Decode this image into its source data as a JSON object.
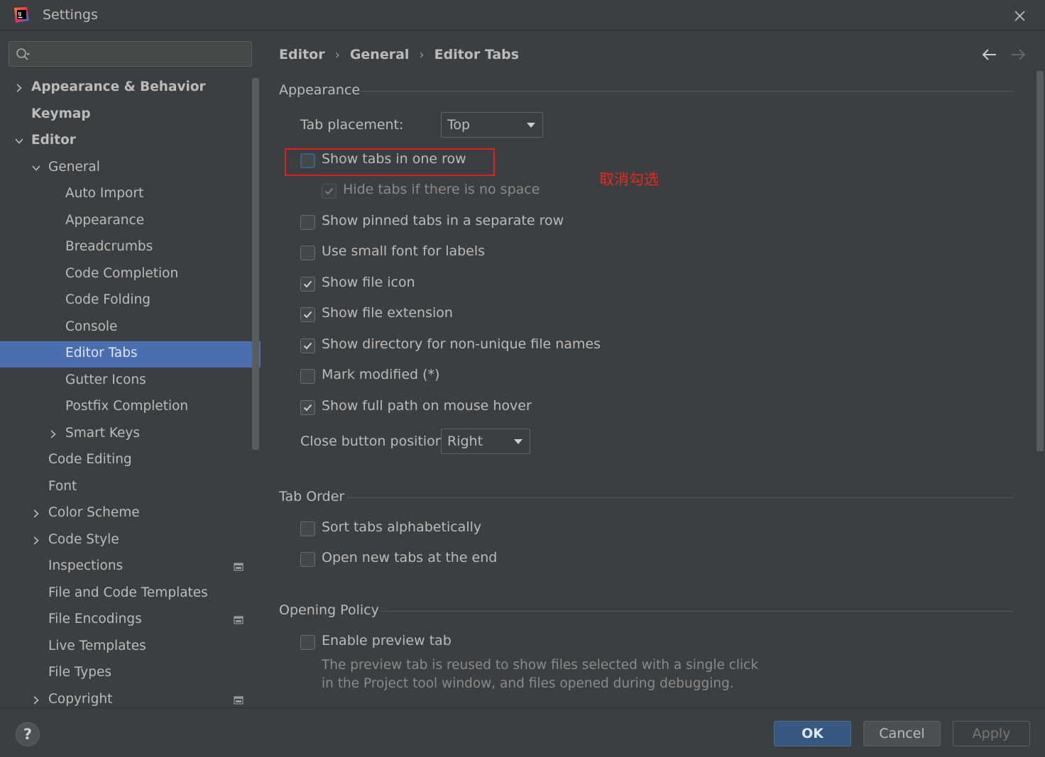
{
  "window": {
    "title": "Settings",
    "logo_icon": "intellij-idea-logo-icon",
    "close_icon": "close-icon"
  },
  "sidebar": {
    "search_placeholder": "",
    "items": [
      {
        "label": "Appearance & Behavior",
        "level": 0,
        "expandable": true,
        "expanded": false,
        "bold": true
      },
      {
        "label": "Keymap",
        "level": 0,
        "expandable": false,
        "bold": true
      },
      {
        "label": "Editor",
        "level": 0,
        "expandable": true,
        "expanded": true,
        "bold": true
      },
      {
        "label": "General",
        "level": 1,
        "expandable": true,
        "expanded": true
      },
      {
        "label": "Auto Import",
        "level": 2
      },
      {
        "label": "Appearance",
        "level": 2
      },
      {
        "label": "Breadcrumbs",
        "level": 2
      },
      {
        "label": "Code Completion",
        "level": 2
      },
      {
        "label": "Code Folding",
        "level": 2
      },
      {
        "label": "Console",
        "level": 2
      },
      {
        "label": "Editor Tabs",
        "level": 2,
        "selected": true
      },
      {
        "label": "Gutter Icons",
        "level": 2
      },
      {
        "label": "Postfix Completion",
        "level": 2
      },
      {
        "label": "Smart Keys",
        "level": 2,
        "expandable": true,
        "expanded": false
      },
      {
        "label": "Code Editing",
        "level": 1
      },
      {
        "label": "Font",
        "level": 1
      },
      {
        "label": "Color Scheme",
        "level": 1,
        "expandable": true,
        "expanded": false
      },
      {
        "label": "Code Style",
        "level": 1,
        "expandable": true,
        "expanded": false
      },
      {
        "label": "Inspections",
        "level": 1,
        "project_icon": true
      },
      {
        "label": "File and Code Templates",
        "level": 1
      },
      {
        "label": "File Encodings",
        "level": 1,
        "project_icon": true
      },
      {
        "label": "Live Templates",
        "level": 1
      },
      {
        "label": "File Types",
        "level": 1
      },
      {
        "label": "Copyright",
        "level": 1,
        "expandable": true,
        "expanded": false,
        "project_icon": true
      }
    ]
  },
  "breadcrumb": {
    "items": [
      "Editor",
      "General",
      "Editor Tabs"
    ],
    "sep": "›"
  },
  "appearance": {
    "title": "Appearance",
    "tab_placement_label": "Tab placement:",
    "tab_placement_value": "Top",
    "options": [
      {
        "label": "Show tabs in one row",
        "checked": false,
        "focused": true
      },
      {
        "label": "Hide tabs if there is no space",
        "checked": true,
        "disabled": true
      },
      {
        "label": "Show pinned tabs in a separate row",
        "checked": false
      },
      {
        "label": "Use small font for labels",
        "checked": false
      },
      {
        "label": "Show file icon",
        "checked": true
      },
      {
        "label": "Show file extension",
        "checked": true
      },
      {
        "label": "Show directory for non-unique file names",
        "checked": true
      },
      {
        "label": "Mark modified (*)",
        "checked": false
      },
      {
        "label": "Show full path on mouse hover",
        "checked": true
      }
    ],
    "close_button_label": "Close button position:",
    "close_button_value": "Right"
  },
  "tab_order": {
    "title": "Tab Order",
    "options": [
      {
        "label": "Sort tabs alphabetically",
        "checked": false
      },
      {
        "label": "Open new tabs at the end",
        "checked": false
      }
    ]
  },
  "opening_policy": {
    "title": "Opening Policy",
    "preview_label": "Enable preview tab",
    "preview_checked": false,
    "description_line1": "The preview tab is reused to show files selected with a single click",
    "description_line2": "in the Project tool window, and files opened during debugging."
  },
  "annotation": {
    "text": "取消勾选",
    "color": "#e8281f"
  },
  "footer": {
    "help": "?",
    "ok": "OK",
    "cancel": "Cancel",
    "apply": "Apply"
  },
  "colors": {
    "background": "#3c3f41",
    "selection": "#4b6eaf",
    "ok_button": "#365880",
    "text": "#bbbbbb"
  }
}
